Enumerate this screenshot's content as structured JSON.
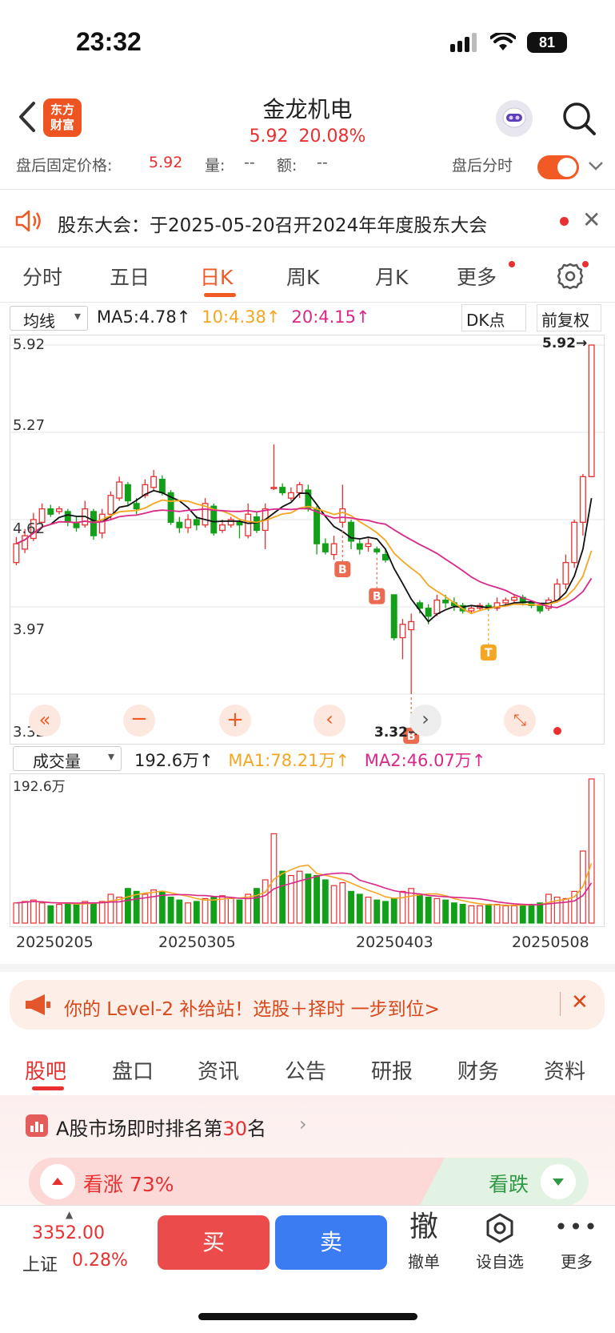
{
  "status_bar": {
    "time": "23:32",
    "battery": "81"
  },
  "header": {
    "logo_line1": "东方",
    "logo_line2": "财富",
    "stock_name": "金龙机电",
    "price": "5.92",
    "change_pct": "20.08%"
  },
  "after_hours": {
    "fixed_price_label": "盘后固定价格:",
    "fixed_price": "5.92",
    "volume_label": "量:",
    "volume": "--",
    "amount_label": "额:",
    "amount": "--",
    "timeshare_label": "盘后分时"
  },
  "notice": {
    "text": "股东大会：于2025-05-20召开2024年年度股东大会"
  },
  "period_tabs": [
    "分时",
    "五日",
    "日K",
    "周K",
    "月K",
    "更多"
  ],
  "chart_header": {
    "ma_select": "均线",
    "ma5": "MA5:4.78",
    "ma10": "10:4.38",
    "ma20": "20:4.15",
    "dk_button": "DK点",
    "fq_button": "前复权"
  },
  "colors": {
    "up": "#e93030",
    "down": "#12a019",
    "ma5": "#111111",
    "ma10": "#f5a623",
    "ma20": "#d9288a",
    "accent": "#f15a24"
  },
  "chart_data": {
    "type": "candlestick",
    "y_axis_labels": [
      "5.92",
      "5.27",
      "4.62",
      "3.97",
      "3.32"
    ],
    "ylim": [
      3.32,
      5.92
    ],
    "high_marker": "5.92",
    "low_marker": "3.32",
    "signal_marks": [
      "B",
      "B",
      "B",
      "T"
    ],
    "candles": [
      {
        "o": 4.3,
        "c": 4.44,
        "h": 4.49,
        "l": 4.28
      },
      {
        "o": 4.4,
        "c": 4.5,
        "h": 4.55,
        "l": 4.37
      },
      {
        "o": 4.48,
        "c": 4.62,
        "h": 4.67,
        "l": 4.46
      },
      {
        "o": 4.6,
        "c": 4.7,
        "h": 4.74,
        "l": 4.57
      },
      {
        "o": 4.7,
        "c": 4.66,
        "h": 4.73,
        "l": 4.64
      },
      {
        "o": 4.68,
        "c": 4.7,
        "h": 4.72,
        "l": 4.66
      },
      {
        "o": 4.68,
        "c": 4.6,
        "h": 4.7,
        "l": 4.57
      },
      {
        "o": 4.6,
        "c": 4.56,
        "h": 4.64,
        "l": 4.53
      },
      {
        "o": 4.58,
        "c": 4.7,
        "h": 4.76,
        "l": 4.56
      },
      {
        "o": 4.68,
        "c": 4.5,
        "h": 4.7,
        "l": 4.47
      },
      {
        "o": 4.52,
        "c": 4.66,
        "h": 4.7,
        "l": 4.48
      },
      {
        "o": 4.66,
        "c": 4.8,
        "h": 4.83,
        "l": 4.62
      },
      {
        "o": 4.78,
        "c": 4.9,
        "h": 4.94,
        "l": 4.76
      },
      {
        "o": 4.88,
        "c": 4.76,
        "h": 4.9,
        "l": 4.72
      },
      {
        "o": 4.74,
        "c": 4.7,
        "h": 4.78,
        "l": 4.66
      },
      {
        "o": 4.8,
        "c": 4.88,
        "h": 4.92,
        "l": 4.78
      },
      {
        "o": 4.86,
        "c": 4.94,
        "h": 4.99,
        "l": 4.84
      },
      {
        "o": 4.92,
        "c": 4.82,
        "h": 4.95,
        "l": 4.8
      },
      {
        "o": 4.82,
        "c": 4.6,
        "h": 4.84,
        "l": 4.58
      },
      {
        "o": 4.6,
        "c": 4.56,
        "h": 4.64,
        "l": 4.52
      },
      {
        "o": 4.56,
        "c": 4.62,
        "h": 4.66,
        "l": 4.52
      },
      {
        "o": 4.62,
        "c": 4.58,
        "h": 4.65,
        "l": 4.54
      },
      {
        "o": 4.58,
        "c": 4.74,
        "h": 4.78,
        "l": 4.56
      },
      {
        "o": 4.72,
        "c": 4.52,
        "h": 4.74,
        "l": 4.5
      },
      {
        "o": 4.54,
        "c": 4.58,
        "h": 4.62,
        "l": 4.52
      },
      {
        "o": 4.58,
        "c": 4.62,
        "h": 4.64,
        "l": 4.56
      },
      {
        "o": 4.6,
        "c": 4.58,
        "h": 4.62,
        "l": 4.48
      },
      {
        "o": 4.5,
        "c": 4.66,
        "h": 4.74,
        "l": 4.48
      },
      {
        "o": 4.64,
        "c": 4.54,
        "h": 4.68,
        "l": 4.52
      },
      {
        "o": 4.54,
        "c": 4.7,
        "h": 4.74,
        "l": 4.4
      },
      {
        "o": 4.86,
        "c": 4.86,
        "h": 5.18,
        "l": 4.84
      },
      {
        "o": 4.86,
        "c": 4.82,
        "h": 4.89,
        "l": 4.8
      },
      {
        "o": 4.78,
        "c": 4.82,
        "h": 4.86,
        "l": 4.76
      },
      {
        "o": 4.82,
        "c": 4.88,
        "h": 4.9,
        "l": 4.78
      },
      {
        "o": 4.84,
        "c": 4.7,
        "h": 4.88,
        "l": 4.68
      },
      {
        "o": 4.7,
        "c": 4.44,
        "h": 4.72,
        "l": 4.36
      },
      {
        "o": 4.44,
        "c": 4.38,
        "h": 4.48,
        "l": 4.36
      },
      {
        "o": 4.36,
        "c": 4.44,
        "h": 4.5,
        "l": 4.32
      },
      {
        "o": 4.6,
        "c": 4.7,
        "h": 4.88,
        "l": 4.56
      },
      {
        "o": 4.6,
        "c": 4.46,
        "h": 4.62,
        "l": 4.4
      },
      {
        "o": 4.44,
        "c": 4.4,
        "h": 4.48,
        "l": 4.36
      },
      {
        "o": 4.42,
        "c": 4.44,
        "h": 4.48,
        "l": 4.38
      },
      {
        "o": 4.4,
        "c": 4.38,
        "h": 4.42,
        "l": 4.36
      },
      {
        "o": 4.36,
        "c": 4.32,
        "h": 4.4,
        "l": 4.3
      },
      {
        "o": 4.06,
        "c": 3.74,
        "h": 4.06,
        "l": 3.72
      },
      {
        "o": 3.74,
        "c": 3.84,
        "h": 3.88,
        "l": 3.58
      },
      {
        "o": 3.8,
        "c": 3.86,
        "h": 3.92,
        "l": 3.32
      },
      {
        "o": 4.0,
        "c": 3.96,
        "h": 4.02,
        "l": 3.92
      },
      {
        "o": 3.96,
        "c": 3.9,
        "h": 3.99,
        "l": 3.84
      },
      {
        "o": 3.92,
        "c": 4.02,
        "h": 4.06,
        "l": 3.9
      },
      {
        "o": 4.02,
        "c": 4.0,
        "h": 4.06,
        "l": 3.96
      },
      {
        "o": 4.0,
        "c": 3.98,
        "h": 4.04,
        "l": 3.94
      },
      {
        "o": 3.98,
        "c": 3.94,
        "h": 4.0,
        "l": 3.92
      },
      {
        "o": 3.94,
        "c": 3.96,
        "h": 3.98,
        "l": 3.92
      },
      {
        "o": 3.96,
        "c": 3.98,
        "h": 4.0,
        "l": 3.94
      },
      {
        "o": 3.98,
        "c": 3.96,
        "h": 4.0,
        "l": 3.94
      },
      {
        "o": 3.96,
        "c": 4.0,
        "h": 4.04,
        "l": 3.94
      },
      {
        "o": 4.0,
        "c": 4.02,
        "h": 4.04,
        "l": 3.98
      },
      {
        "o": 4.02,
        "c": 4.04,
        "h": 4.06,
        "l": 4.0
      },
      {
        "o": 4.04,
        "c": 4.0,
        "h": 4.06,
        "l": 3.98
      },
      {
        "o": 4.0,
        "c": 3.98,
        "h": 4.02,
        "l": 3.96
      },
      {
        "o": 3.98,
        "c": 3.94,
        "h": 4.0,
        "l": 3.92
      },
      {
        "o": 3.96,
        "c": 4.02,
        "h": 4.04,
        "l": 3.94
      },
      {
        "o": 4.02,
        "c": 4.14,
        "h": 4.18,
        "l": 4.0
      },
      {
        "o": 4.14,
        "c": 4.3,
        "h": 4.36,
        "l": 4.1
      },
      {
        "o": 4.3,
        "c": 4.6,
        "h": 4.62,
        "l": 4.26
      },
      {
        "o": 4.6,
        "c": 4.94,
        "h": 4.96,
        "l": 4.5
      },
      {
        "o": 4.94,
        "c": 5.92,
        "h": 5.92,
        "l": 4.94
      }
    ],
    "volume_label_top": "192.6万",
    "volumes": [
      14,
      15,
      16,
      14,
      12,
      13,
      14,
      13,
      15,
      14,
      15,
      20,
      18,
      24,
      22,
      20,
      23,
      22,
      18,
      16,
      14,
      15,
      17,
      18,
      19,
      17,
      16,
      20,
      24,
      30,
      62,
      36,
      33,
      36,
      34,
      33,
      30,
      26,
      28,
      22,
      20,
      18,
      16,
      15,
      17,
      22,
      24,
      20,
      18,
      17,
      16,
      14,
      13,
      12,
      12,
      13,
      13,
      12,
      12,
      13,
      13,
      14,
      20,
      18,
      17,
      22,
      50,
      100
    ],
    "dates": [
      "20250205",
      "20250305",
      "20250403",
      "20250508"
    ]
  },
  "volume_header": {
    "select": "成交量",
    "vol": "192.6万",
    "ma1": "MA1:78.21万",
    "ma2": "MA2:46.07万"
  },
  "promo": {
    "text": "你的 Level-2 补给站！选股＋择时 一步到位>"
  },
  "section_tabs": [
    "股吧",
    "盘口",
    "资讯",
    "公告",
    "研报",
    "财务",
    "资料"
  ],
  "ranking": {
    "prefix": "A股市场即时排名第",
    "rank": "30",
    "suffix": "名"
  },
  "vote": {
    "up_label": "看涨",
    "up_pct": "73%",
    "down_label": "看跌"
  },
  "bottom": {
    "index_value": "3352.00",
    "index_name": "上证",
    "index_pct": "0.28%",
    "buy": "买",
    "sell": "卖",
    "tools": [
      {
        "icon": "撤",
        "label": "撤单"
      },
      {
        "icon": "⬡",
        "label": "设自选"
      },
      {
        "icon": "•••",
        "label": "更多"
      }
    ]
  }
}
